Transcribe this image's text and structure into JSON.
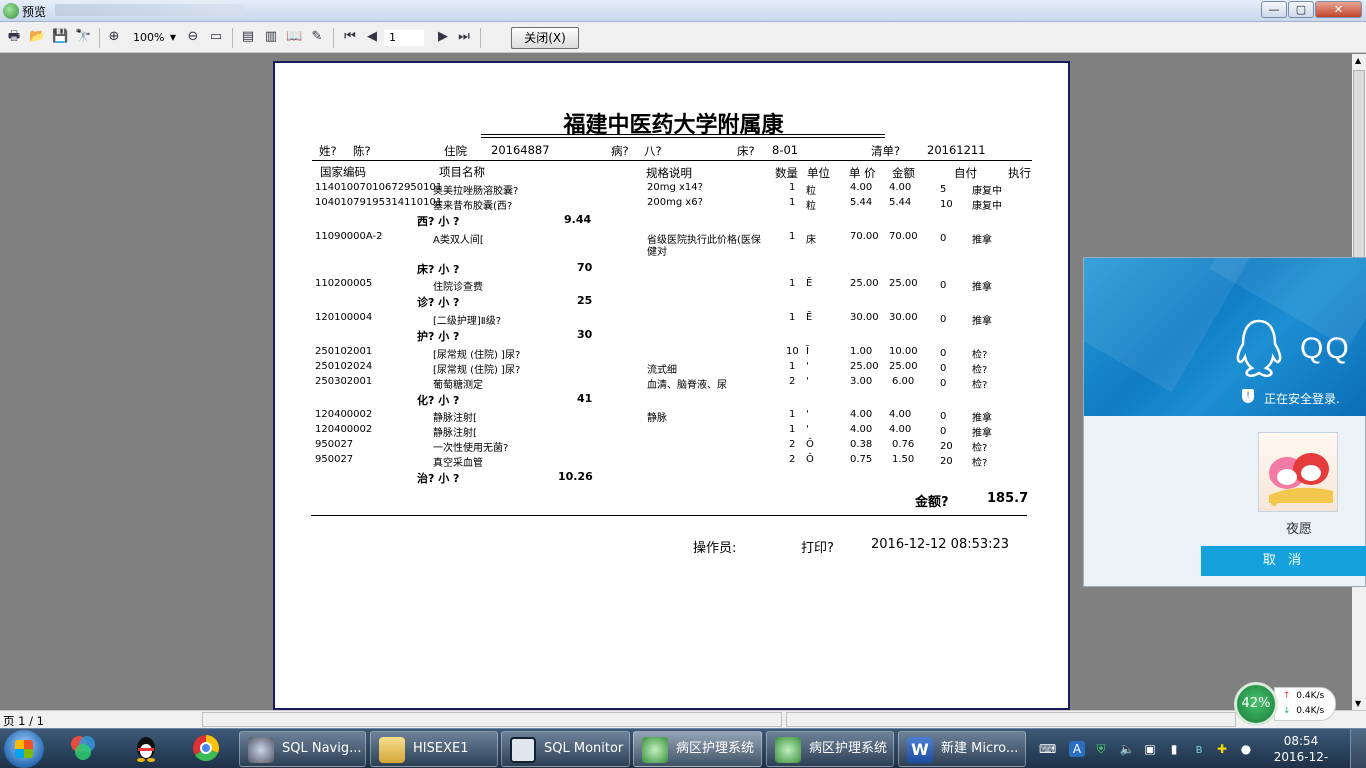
{
  "window": {
    "title": "预览"
  },
  "toolbar": {
    "zoom": "100%",
    "page": "1",
    "close_label": "关闭(X)"
  },
  "report": {
    "title": "福建中医药大学附属康",
    "header": {
      "name_label": "姓?",
      "name": "陈?",
      "inpatient_label": "住院",
      "inpatient_no": "20164887",
      "ward_label": "病?",
      "ward": "八?",
      "bed_label": "床?",
      "bed": "8-01",
      "list_label": "清单?",
      "list_no": "20161211"
    },
    "columns": [
      "国家编码",
      "项目名称",
      "规格说明",
      "数量",
      "单位",
      "单 价",
      "金额",
      "自付",
      "执行"
    ],
    "rows": [
      {
        "code": "114010070106729501​01",
        "name": "奥美拉唑肠溶胶囊?",
        "spec": "20mg x14?",
        "qty": "1",
        "unit": "粒",
        "price": "4.00",
        "amount": "4.00",
        "self": "5",
        "exec": "康复中"
      },
      {
        "code": "104010791953141101​01",
        "name": "塞来昔布胶囊(西?",
        "spec": "200mg x6?",
        "qty": "1",
        "unit": "粒",
        "price": "5.44",
        "amount": "5.44",
        "self": "10",
        "exec": "康复中"
      }
    ],
    "subtotals": [
      {
        "label": "西? 小  ?",
        "value": "9.44"
      },
      {
        "label": "床? 小  ?",
        "value": "70"
      },
      {
        "label": "诊? 小  ?",
        "value": "25"
      },
      {
        "label": "护? 小  ?",
        "value": "30"
      },
      {
        "label": "化? 小  ?",
        "value": "41"
      },
      {
        "label": "治? 小  ?",
        "value": "10.26"
      }
    ],
    "items": [
      {
        "code": "11090000A-2",
        "name": "A类双人间[",
        "spec": "省级医院执行此价格(医保",
        "spec2": "健对",
        "qty": "1",
        "unit": "床",
        "price": "70.00",
        "amount": "70.00",
        "self": "0",
        "exec": "推拿"
      },
      {
        "code": "110200005",
        "name": "住院诊查费",
        "spec": "",
        "qty": "1",
        "unit": "Ē",
        "price": "25.00",
        "amount": "25.00",
        "self": "0",
        "exec": "推拿"
      },
      {
        "code": "120100004",
        "name": "[二级护理]Ⅱ级?",
        "spec": "",
        "qty": "1",
        "unit": "Ē",
        "price": "30.00",
        "amount": "30.00",
        "self": "0",
        "exec": "推拿"
      },
      {
        "code": "250102001",
        "name": "[尿常规 (住院) ]尿?",
        "spec": "",
        "qty": "10",
        "unit": "Ī",
        "price": "1.00",
        "amount": "10.00",
        "self": "0",
        "exec": "检?"
      },
      {
        "code": "250102024",
        "name": "[尿常规 (住院) ]尿?",
        "spec": "流式细",
        "qty": "1",
        "unit": "'",
        "price": "25.00",
        "amount": "25.00",
        "self": "0",
        "exec": "检?"
      },
      {
        "code": "250302001",
        "name": "葡萄糖测定",
        "spec": "血清、脑脊液、尿",
        "qty": "2",
        "unit": "'",
        "price": "3.00",
        "amount": "6.00",
        "self": "0",
        "exec": "检?"
      },
      {
        "code": "120400002",
        "name": "静脉注射[",
        "spec": "静脉",
        "qty": "1",
        "unit": "'",
        "price": "4.00",
        "amount": "4.00",
        "self": "0",
        "exec": "推拿"
      },
      {
        "code": "120400002",
        "name": "静脉注射[",
        "spec": "",
        "qty": "1",
        "unit": "'",
        "price": "4.00",
        "amount": "4.00",
        "self": "0",
        "exec": "推拿"
      },
      {
        "code": "950027",
        "name": "一次性使用无菌?",
        "spec": "",
        "qty": "2",
        "unit": "Ô",
        "price": "0.38",
        "amount": "0.76",
        "self": "20",
        "exec": "检?"
      },
      {
        "code": "950027",
        "name": "真空采血管",
        "spec": "",
        "qty": "2",
        "unit": "Ô",
        "price": "0.75",
        "amount": "1.50",
        "self": "20",
        "exec": "检?"
      }
    ],
    "total_label": "金额?",
    "total_value": "185.7",
    "operator_label": "操作员:",
    "print_label": "打印?",
    "print_time": "2016-12-12  08:53:23"
  },
  "statusbar": {
    "page_info": "页 1 / 1"
  },
  "qq": {
    "brand": "QQ",
    "status": "正在安全登录.",
    "nickname": "夜愿",
    "cancel_label": "取 消",
    "accent": "#15a2dc"
  },
  "netmon": {
    "percent": "42%",
    "up": "0.4K/s",
    "down": "0.4K/s"
  },
  "taskbar": {
    "tasks": [
      {
        "label": "SQL Navig..."
      },
      {
        "label": "HISEXE1"
      },
      {
        "label": "SQL Monitor"
      },
      {
        "label": "病区护理系统"
      },
      {
        "label": "病区护理系统"
      },
      {
        "label": "新建 Micro..."
      }
    ],
    "time": "08:54",
    "date": "2016-12-12"
  }
}
